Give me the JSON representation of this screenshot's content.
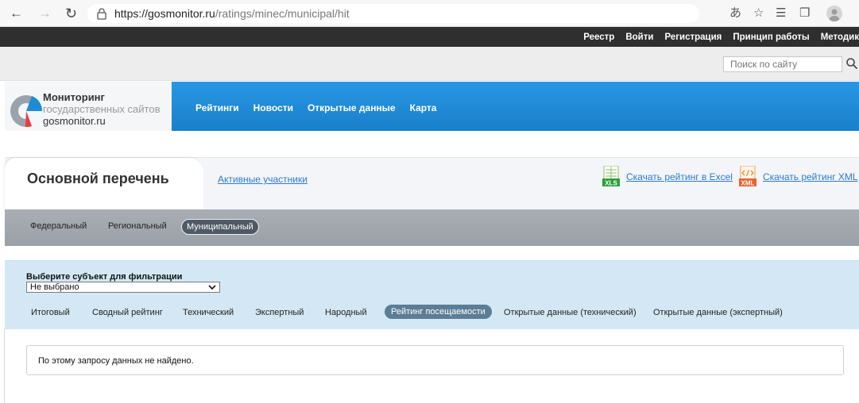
{
  "browser": {
    "url_domain": "https://gosmonitor.ru",
    "url_path": "/ratings/minec/municipal/hit"
  },
  "topbar": {
    "links": [
      "Реестр",
      "Войти",
      "Регистрация",
      "Принцип работы",
      "Методик"
    ]
  },
  "search": {
    "placeholder": "Поиск по сайту"
  },
  "logo": {
    "line1": "Мониторинг",
    "line2": "государственных сайтов",
    "line3": "gosmonitor.ru"
  },
  "mainnav": [
    "Рейтинги",
    "Новости",
    "Открытые данные",
    "Карта"
  ],
  "tabs": {
    "active": "Основной перечень",
    "other": "Активные участники",
    "excel_link": "Скачать рейтинг в Excel",
    "xml_link": "Скачать рейтинг XML",
    "excel_icon": "XLS",
    "xml_icon": "XML"
  },
  "categories": {
    "items": [
      "Федеральный",
      "Региональный",
      "Муниципальный"
    ],
    "selected": "Муниципальный"
  },
  "filter": {
    "label": "Выберите субъект для фильтрации",
    "selected_value": "Не выбрано"
  },
  "subtabs": {
    "items": [
      "Итоговый",
      "Сводный рейтинг",
      "Технический",
      "Экспертный",
      "Народный",
      "Рейтинг посещаемости",
      "Открытые данные (технический)",
      "Открытые данные (экспертный)"
    ],
    "selected": "Рейтинг посещаемости"
  },
  "message": "По этому запросу данных не найдено.",
  "colors": {
    "header_blue": "#1f8bd6",
    "link_blue": "#2b7bd0",
    "pill_dark": "#4f5a66",
    "pill_blue": "#5b7d95",
    "filter_bg": "#d3e8f4"
  }
}
